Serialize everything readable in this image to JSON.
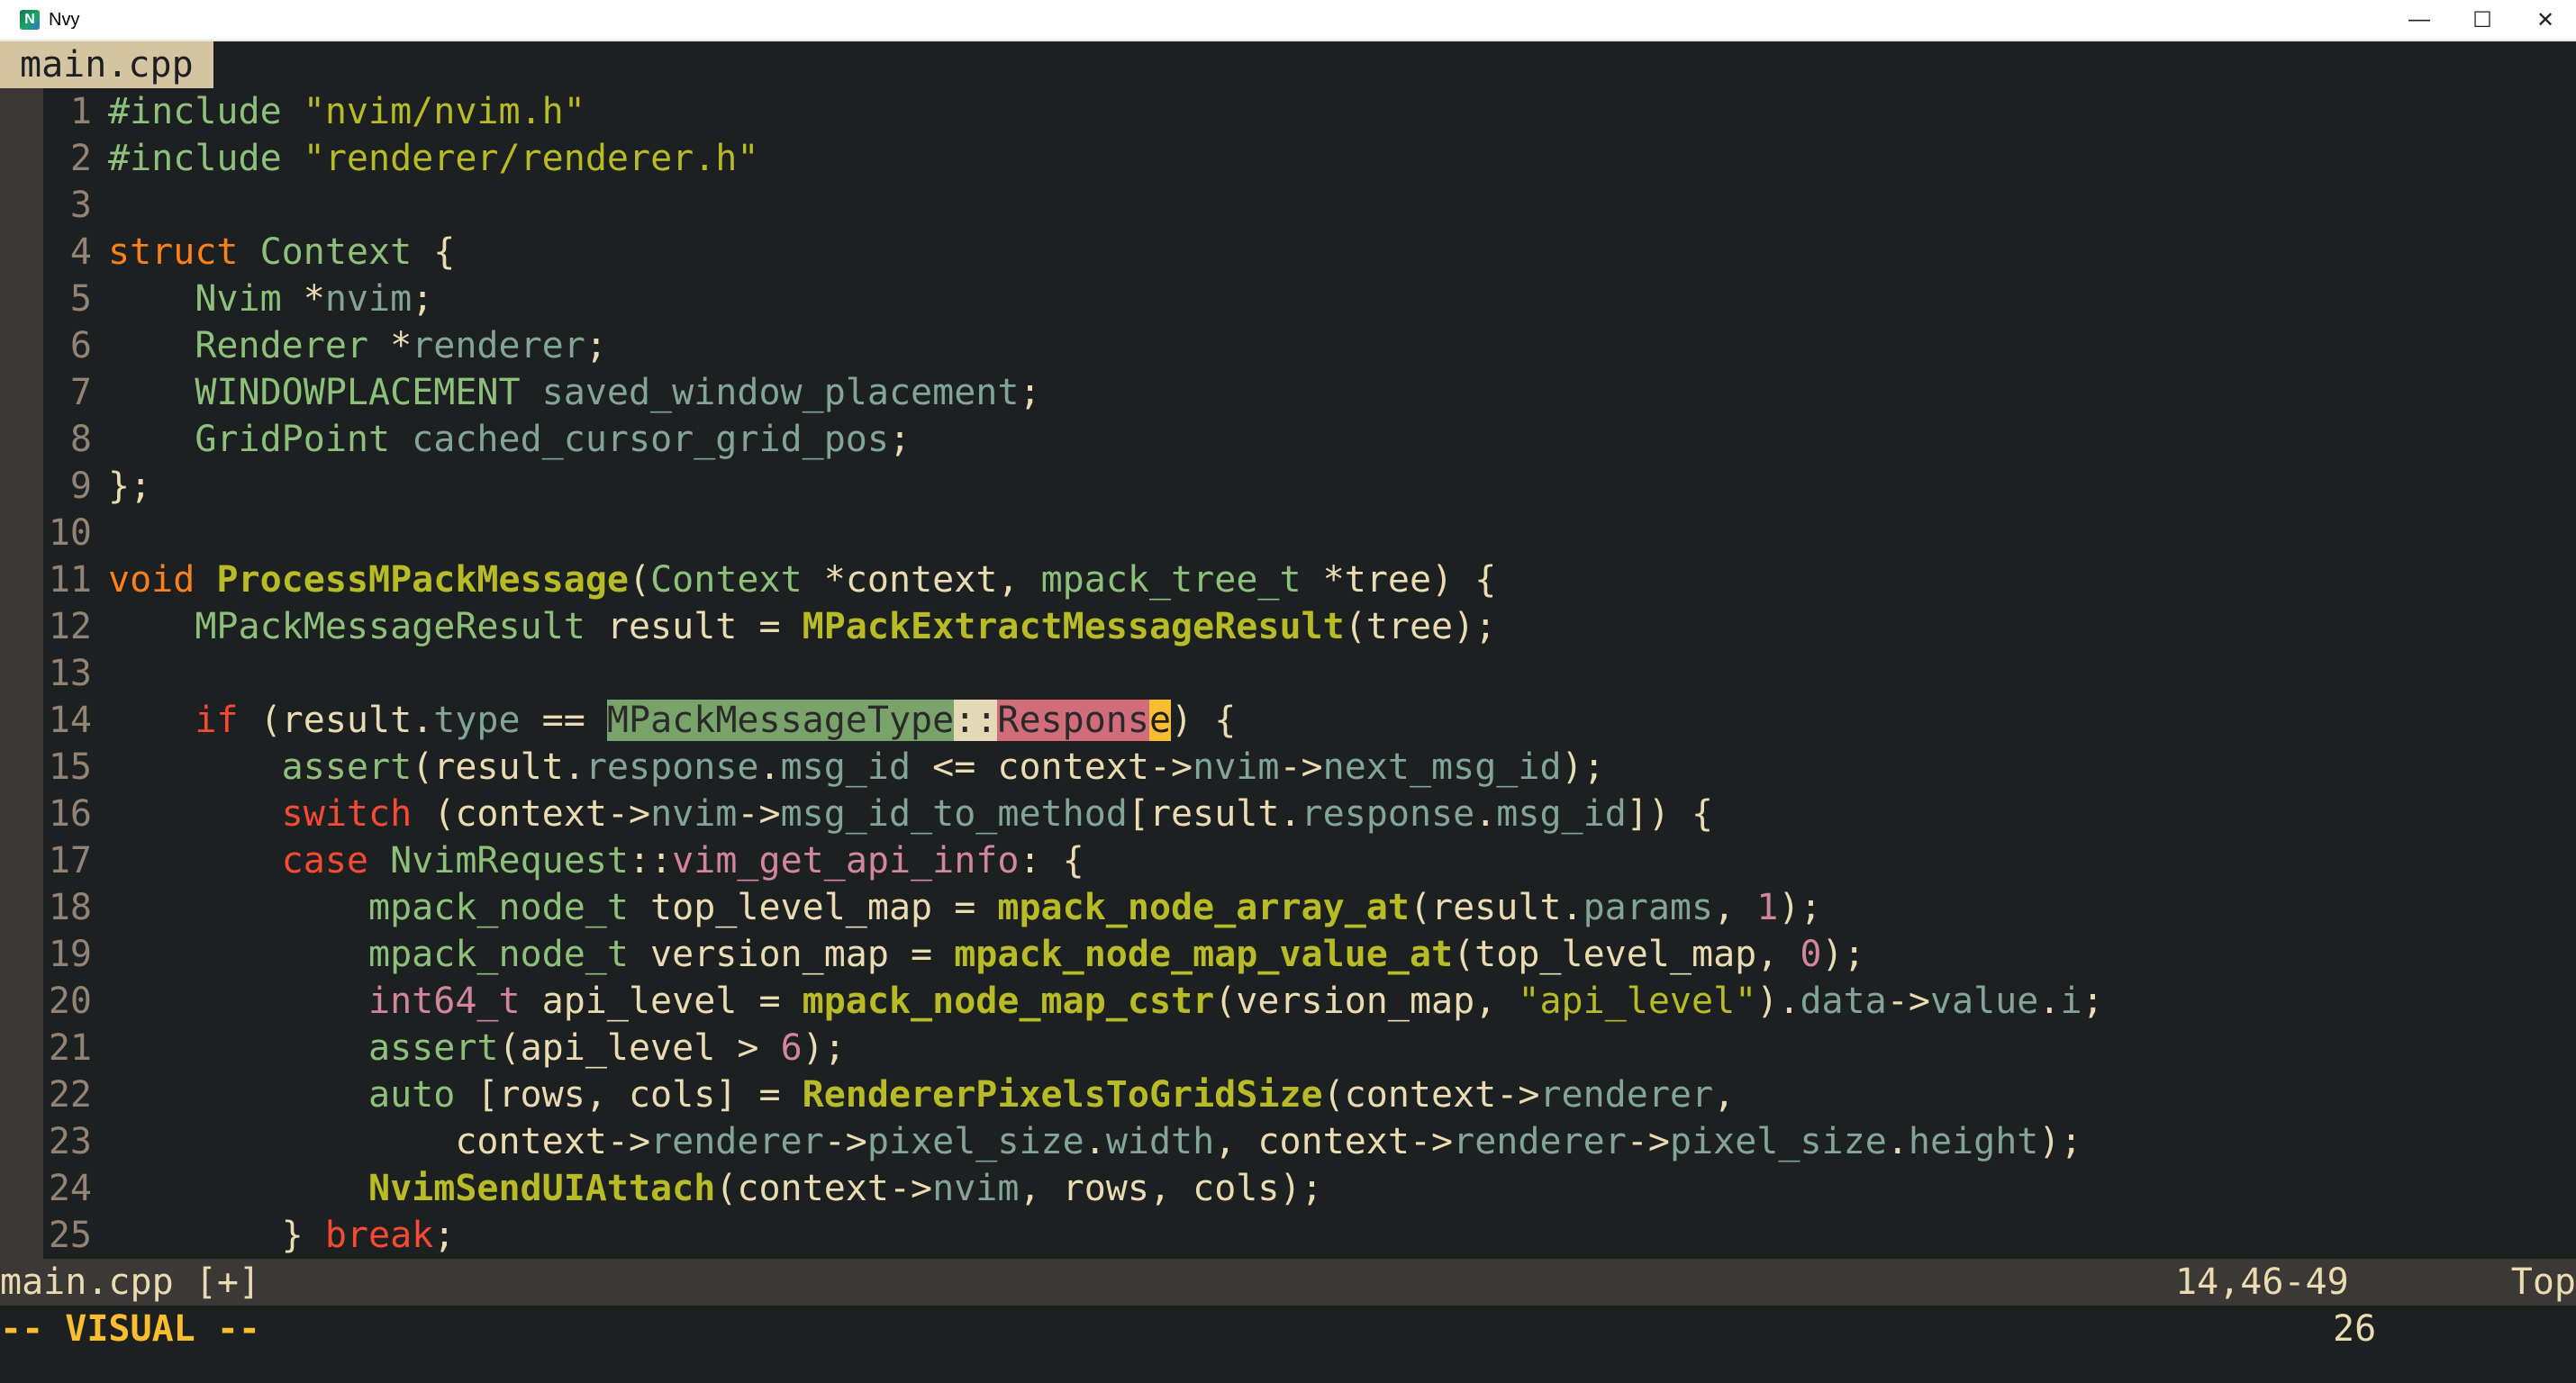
{
  "window": {
    "title": "Nvy",
    "icon_name": "neovim-icon",
    "controls": {
      "minimize": "—",
      "maximize": "☐",
      "close": "✕"
    }
  },
  "tabs": {
    "active": "main.cpp"
  },
  "code": {
    "lines": [
      {
        "n": "1",
        "segments": [
          {
            "t": "#include ",
            "c": "pp"
          },
          {
            "t": "\"nvim/nvim.h\"",
            "c": "str"
          }
        ]
      },
      {
        "n": "2",
        "segments": [
          {
            "t": "#include ",
            "c": "pp"
          },
          {
            "t": "\"renderer/renderer.h\"",
            "c": "str"
          }
        ]
      },
      {
        "n": "3",
        "segments": [
          {
            "t": "",
            "c": "punc"
          }
        ]
      },
      {
        "n": "4",
        "segments": [
          {
            "t": "struct ",
            "c": "kw2"
          },
          {
            "t": "Context",
            "c": "ty"
          },
          {
            "t": " {",
            "c": "punc"
          }
        ]
      },
      {
        "n": "5",
        "segments": [
          {
            "t": "    ",
            "c": "punc"
          },
          {
            "t": "Nvim",
            "c": "ty"
          },
          {
            "t": " *",
            "c": "op"
          },
          {
            "t": "nvim",
            "c": "field"
          },
          {
            "t": ";",
            "c": "punc"
          }
        ]
      },
      {
        "n": "6",
        "segments": [
          {
            "t": "    ",
            "c": "punc"
          },
          {
            "t": "Renderer",
            "c": "ty"
          },
          {
            "t": " *",
            "c": "op"
          },
          {
            "t": "renderer",
            "c": "field"
          },
          {
            "t": ";",
            "c": "punc"
          }
        ]
      },
      {
        "n": "7",
        "segments": [
          {
            "t": "    ",
            "c": "punc"
          },
          {
            "t": "WINDOWPLACEMENT",
            "c": "ty"
          },
          {
            "t": " saved_window_placement",
            "c": "field"
          },
          {
            "t": ";",
            "c": "punc"
          }
        ]
      },
      {
        "n": "8",
        "segments": [
          {
            "t": "    ",
            "c": "punc"
          },
          {
            "t": "GridPoint",
            "c": "ty"
          },
          {
            "t": " cached_cursor_grid_pos",
            "c": "field"
          },
          {
            "t": ";",
            "c": "punc"
          }
        ]
      },
      {
        "n": "9",
        "segments": [
          {
            "t": "};",
            "c": "punc"
          }
        ]
      },
      {
        "n": "10",
        "segments": [
          {
            "t": "",
            "c": "punc"
          }
        ]
      },
      {
        "n": "11",
        "segments": [
          {
            "t": "void ",
            "c": "kw2"
          },
          {
            "t": "ProcessMPackMessage",
            "c": "fn"
          },
          {
            "t": "(",
            "c": "punc"
          },
          {
            "t": "Context",
            "c": "ty"
          },
          {
            "t": " *",
            "c": "op"
          },
          {
            "t": "context",
            "c": "punc"
          },
          {
            "t": ", ",
            "c": "punc"
          },
          {
            "t": "mpack_tree_t",
            "c": "ty"
          },
          {
            "t": " *",
            "c": "op"
          },
          {
            "t": "tree",
            "c": "punc"
          },
          {
            "t": ") {",
            "c": "punc"
          }
        ]
      },
      {
        "n": "12",
        "segments": [
          {
            "t": "    ",
            "c": "punc"
          },
          {
            "t": "MPackMessageResult",
            "c": "ty"
          },
          {
            "t": " result = ",
            "c": "punc"
          },
          {
            "t": "MPackExtractMessageResult",
            "c": "fn"
          },
          {
            "t": "(tree);",
            "c": "punc"
          }
        ]
      },
      {
        "n": "13",
        "segments": [
          {
            "t": "",
            "c": "punc"
          }
        ]
      },
      {
        "n": "14",
        "segments": [
          {
            "t": "    ",
            "c": "punc"
          },
          {
            "t": "if",
            "c": "kw"
          },
          {
            "t": " (result.",
            "c": "punc"
          },
          {
            "t": "type",
            "c": "field"
          },
          {
            "t": " == ",
            "c": "punc"
          },
          {
            "t": "MPackMessageType",
            "c": "sel1"
          },
          {
            "t": "::",
            "c": "sel2"
          },
          {
            "t": "Respons",
            "c": "sel3"
          },
          {
            "t": "e",
            "c": "cursor"
          },
          {
            "t": ") {",
            "c": "punc"
          }
        ]
      },
      {
        "n": "15",
        "segments": [
          {
            "t": "        ",
            "c": "punc"
          },
          {
            "t": "assert",
            "c": "ty"
          },
          {
            "t": "(result.",
            "c": "punc"
          },
          {
            "t": "response",
            "c": "field"
          },
          {
            "t": ".",
            "c": "punc"
          },
          {
            "t": "msg_id",
            "c": "field"
          },
          {
            "t": " <= context->",
            "c": "punc"
          },
          {
            "t": "nvim",
            "c": "field"
          },
          {
            "t": "->",
            "c": "punc"
          },
          {
            "t": "next_msg_id",
            "c": "field"
          },
          {
            "t": ");",
            "c": "punc"
          }
        ]
      },
      {
        "n": "16",
        "segments": [
          {
            "t": "        ",
            "c": "punc"
          },
          {
            "t": "switch",
            "c": "kw"
          },
          {
            "t": " (context->",
            "c": "punc"
          },
          {
            "t": "nvim",
            "c": "field"
          },
          {
            "t": "->",
            "c": "punc"
          },
          {
            "t": "msg_id_to_method",
            "c": "field"
          },
          {
            "t": "[result.",
            "c": "punc"
          },
          {
            "t": "response",
            "c": "field"
          },
          {
            "t": ".",
            "c": "punc"
          },
          {
            "t": "msg_id",
            "c": "field"
          },
          {
            "t": "]) {",
            "c": "punc"
          }
        ]
      },
      {
        "n": "17",
        "segments": [
          {
            "t": "        ",
            "c": "punc"
          },
          {
            "t": "case",
            "c": "kw"
          },
          {
            "t": " ",
            "c": "punc"
          },
          {
            "t": "NvimRequest",
            "c": "ty"
          },
          {
            "t": "::",
            "c": "punc"
          },
          {
            "t": "vim_get_api_info",
            "c": "num"
          },
          {
            "t": ": {",
            "c": "punc"
          }
        ]
      },
      {
        "n": "18",
        "segments": [
          {
            "t": "            ",
            "c": "punc"
          },
          {
            "t": "mpack_node_t",
            "c": "ty"
          },
          {
            "t": " top_level_map = ",
            "c": "punc"
          },
          {
            "t": "mpack_node_array_at",
            "c": "fn"
          },
          {
            "t": "(result.",
            "c": "punc"
          },
          {
            "t": "params",
            "c": "field"
          },
          {
            "t": ", ",
            "c": "punc"
          },
          {
            "t": "1",
            "c": "num"
          },
          {
            "t": ");",
            "c": "punc"
          }
        ]
      },
      {
        "n": "19",
        "segments": [
          {
            "t": "            ",
            "c": "punc"
          },
          {
            "t": "mpack_node_t",
            "c": "ty"
          },
          {
            "t": " version_map = ",
            "c": "punc"
          },
          {
            "t": "mpack_node_map_value_at",
            "c": "fn"
          },
          {
            "t": "(top_level_map, ",
            "c": "punc"
          },
          {
            "t": "0",
            "c": "num"
          },
          {
            "t": ");",
            "c": "punc"
          }
        ]
      },
      {
        "n": "20",
        "segments": [
          {
            "t": "            ",
            "c": "punc"
          },
          {
            "t": "int64_t",
            "c": "num"
          },
          {
            "t": " api_level = ",
            "c": "punc"
          },
          {
            "t": "mpack_node_map_cstr",
            "c": "fn"
          },
          {
            "t": "(version_map, ",
            "c": "punc"
          },
          {
            "t": "\"api_level\"",
            "c": "str"
          },
          {
            "t": ").",
            "c": "punc"
          },
          {
            "t": "data",
            "c": "field"
          },
          {
            "t": "->",
            "c": "punc"
          },
          {
            "t": "value",
            "c": "field"
          },
          {
            "t": ".",
            "c": "punc"
          },
          {
            "t": "i",
            "c": "field"
          },
          {
            "t": ";",
            "c": "punc"
          }
        ]
      },
      {
        "n": "21",
        "segments": [
          {
            "t": "            ",
            "c": "punc"
          },
          {
            "t": "assert",
            "c": "ty"
          },
          {
            "t": "(api_level > ",
            "c": "punc"
          },
          {
            "t": "6",
            "c": "num"
          },
          {
            "t": ");",
            "c": "punc"
          }
        ]
      },
      {
        "n": "22",
        "segments": [
          {
            "t": "            ",
            "c": "punc"
          },
          {
            "t": "auto",
            "c": "ty"
          },
          {
            "t": " [rows, cols] = ",
            "c": "punc"
          },
          {
            "t": "RendererPixelsToGridSize",
            "c": "fn"
          },
          {
            "t": "(context->",
            "c": "punc"
          },
          {
            "t": "renderer",
            "c": "field"
          },
          {
            "t": ",",
            "c": "punc"
          }
        ]
      },
      {
        "n": "23",
        "segments": [
          {
            "t": "                ",
            "c": "punc"
          },
          {
            "t": "context->",
            "c": "punc"
          },
          {
            "t": "renderer",
            "c": "field"
          },
          {
            "t": "->",
            "c": "punc"
          },
          {
            "t": "pixel_size",
            "c": "field"
          },
          {
            "t": ".",
            "c": "punc"
          },
          {
            "t": "width",
            "c": "field"
          },
          {
            "t": ", context->",
            "c": "punc"
          },
          {
            "t": "renderer",
            "c": "field"
          },
          {
            "t": "->",
            "c": "punc"
          },
          {
            "t": "pixel_size",
            "c": "field"
          },
          {
            "t": ".",
            "c": "punc"
          },
          {
            "t": "height",
            "c": "field"
          },
          {
            "t": ");",
            "c": "punc"
          }
        ]
      },
      {
        "n": "24",
        "segments": [
          {
            "t": "            ",
            "c": "punc"
          },
          {
            "t": "NvimSendUIAttach",
            "c": "fn"
          },
          {
            "t": "(context->",
            "c": "punc"
          },
          {
            "t": "nvim",
            "c": "field"
          },
          {
            "t": ", rows, cols);",
            "c": "punc"
          }
        ]
      },
      {
        "n": "25",
        "segments": [
          {
            "t": "        ",
            "c": "punc"
          },
          {
            "t": "} ",
            "c": "punc"
          },
          {
            "t": "break",
            "c": "kw"
          },
          {
            "t": ";",
            "c": "punc"
          }
        ]
      }
    ]
  },
  "status": {
    "file": "main.cpp [+]",
    "position": "14,46-49",
    "scroll": "Top"
  },
  "cmdline": {
    "mode": "-- VISUAL --",
    "count": "26"
  },
  "colors": {
    "editor_bg": "#1d2021",
    "gutter_bg": "#3c3836",
    "status_bg": "#3c3836",
    "tab_bg": "#d5c4a1",
    "accent_yellow": "#fabd2f",
    "keyword_red": "#fb4934",
    "keyword_orange": "#fe8019",
    "type_aqua": "#8ec07c",
    "function_green": "#b8bb26",
    "number_purple": "#d3869b",
    "field_blue": "#83a598"
  }
}
